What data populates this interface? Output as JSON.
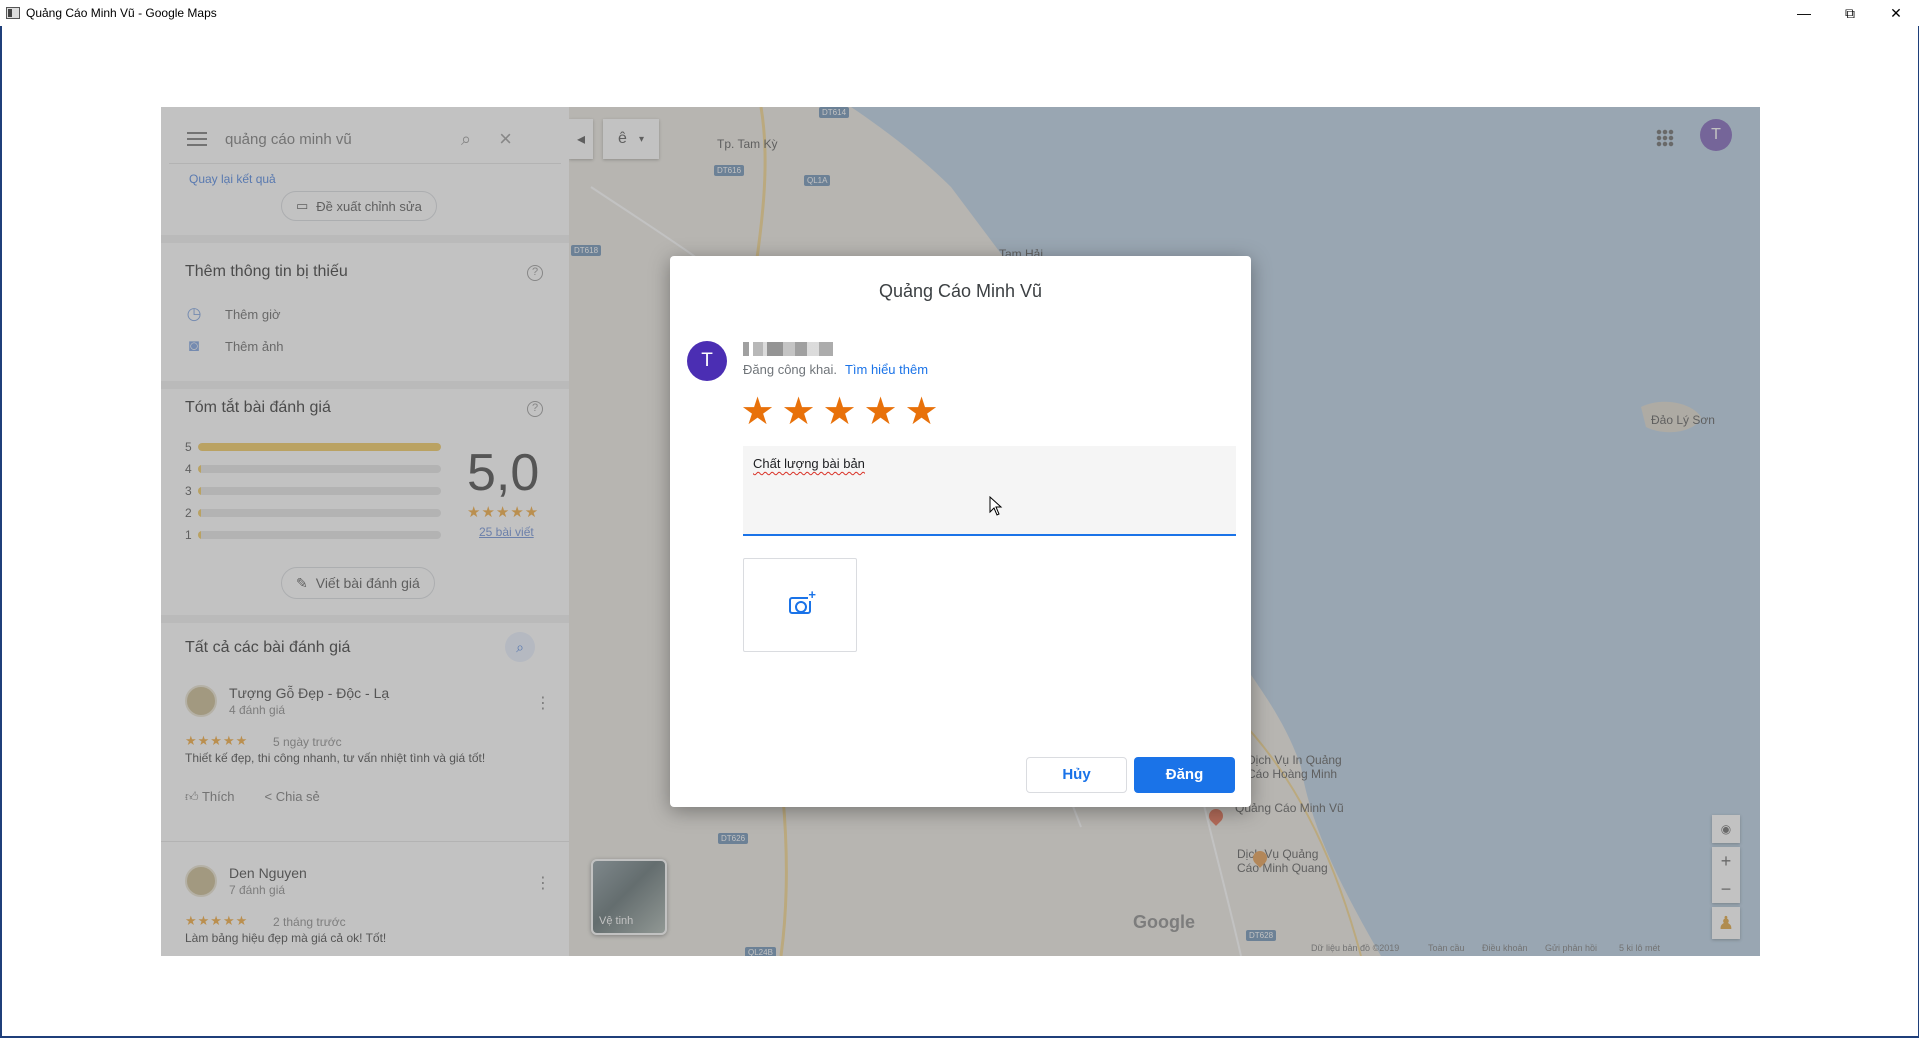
{
  "window": {
    "title": "Quảng Cáo Minh Vũ - Google Maps",
    "minimize": "—",
    "maximize": "⧉",
    "close": "✕"
  },
  "search": {
    "value": "quảng cáo minh vũ",
    "back_to_results": "Quay lại kết quả"
  },
  "map_controls": {
    "collapse": "◂",
    "direction": "ê",
    "direction_arrow": "▾",
    "account_initial": "T",
    "satellite_label": "Vệ tinh",
    "zoom_in": "+",
    "zoom_out": "−",
    "google_logo": "Google",
    "footer": [
      "Dữ liệu bản đồ ©2019",
      "Toàn cầu",
      "Điều khoản",
      "Gửi phản hồi",
      "5 ki lô mét"
    ]
  },
  "map_labels": {
    "tam_ky": "Tp. Tam Kỳ",
    "tam_hai": "Tam Hải",
    "dao_ly_son": "Đảo Lý Sơn",
    "dv_quang_cao_hoang_minh_1": "Dịch Vụ In Quảng",
    "dv_quang_cao_hoang_minh_2": "Cáo Hoàng Minh",
    "quang_cao_minh_vu": "Quảng Cáo Minh Vũ",
    "dv_minh_quang_1": "Dịch Vụ Quảng",
    "dv_minh_quang_2": "Cáo Minh Quang",
    "roads": [
      "DT614",
      "DT616",
      "QL1A",
      "DT618",
      "DT626",
      "QL24B",
      "DT628",
      "DT6"
    ]
  },
  "panel": {
    "suggest_edit": "Đề xuất chỉnh sửa",
    "missing_title": "Thêm thông tin bị thiếu",
    "add_hours": "Thêm giờ",
    "add_photos": "Thêm ảnh",
    "summary_title": "Tóm tắt bài đánh giá",
    "rating_rows": [
      {
        "label": "5",
        "fraction": 1.0
      },
      {
        "label": "4",
        "fraction": 0
      },
      {
        "label": "3",
        "fraction": 0
      },
      {
        "label": "2",
        "fraction": 0
      },
      {
        "label": "1",
        "fraction": 0
      }
    ],
    "score": "5,0",
    "score_stars": "★★★★★",
    "review_count": "25 bài viết",
    "write_review": "Viết bài đánh giá",
    "all_reviews_title": "Tất cả các bài đánh giá",
    "reviews": [
      {
        "name": "Tượng Gỗ Đẹp - Độc - Lạ",
        "sub": "4 đánh giá",
        "stars": "★★★★★",
        "date": "5 ngày trước",
        "text": "Thiết kế đẹp, thi công nhanh, tư vấn nhiệt tình và giá tốt!",
        "like": "Thích",
        "share": "Chia sẻ"
      },
      {
        "name": "Den Nguyen",
        "sub": "7 đánh giá",
        "stars": "★★★★★",
        "date": "2 tháng trước",
        "text": "Làm bảng hiệu đẹp mà giá cả ok! Tốt!"
      }
    ]
  },
  "dialog": {
    "title": "Quảng Cáo Minh Vũ",
    "avatar_initial": "T",
    "public_note": "Đăng công khai.",
    "learn_more": "Tìm hiểu thêm",
    "rating": 5,
    "star": "★",
    "review_text": "Chất lượng bài bản",
    "cancel": "Hủy",
    "post": "Đăng"
  },
  "colors": {
    "accent": "#1a73e8",
    "star": "#e8710a",
    "avatar": "#4b2eb3"
  }
}
